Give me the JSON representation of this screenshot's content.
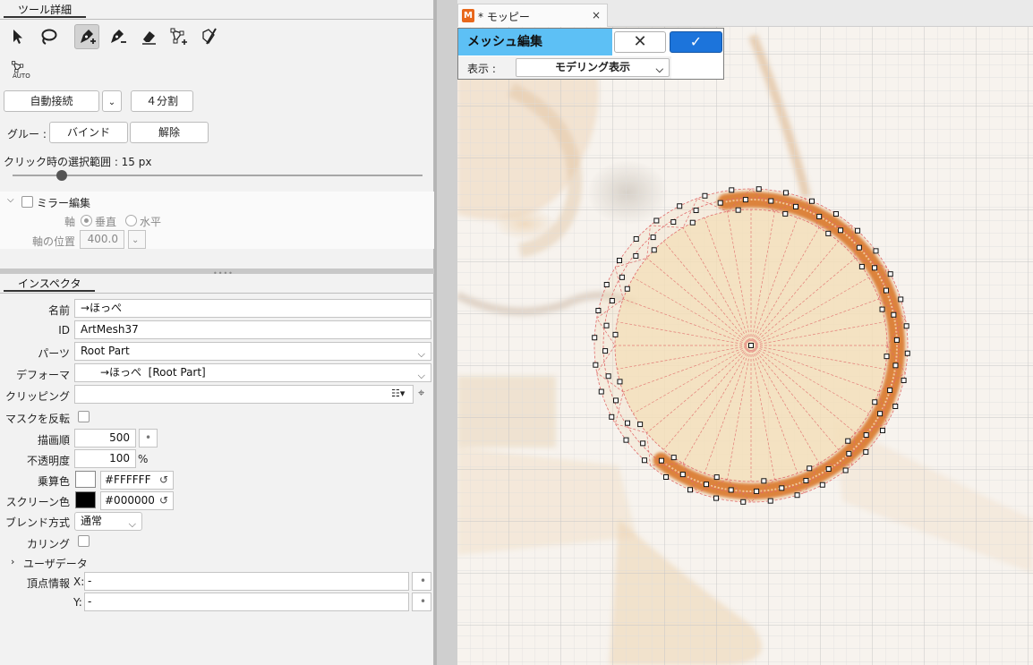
{
  "tool_details": {
    "tab_label": "ツール詳細",
    "tools": [
      {
        "name": "select-arrow-icon"
      },
      {
        "name": "lasso-icon"
      },
      {
        "name": "pen-add-icon",
        "active": true
      },
      {
        "name": "pen-remove-icon"
      },
      {
        "name": "eraser-icon"
      },
      {
        "name": "vertex-add-icon"
      },
      {
        "name": "knife-icon"
      },
      {
        "name": "auto-mesh-icon"
      }
    ],
    "auto_label": "AUTO",
    "connect_mode": "自動接続",
    "split_label": "４分割",
    "glue_label": "グルー :",
    "bind_label": "バインド",
    "release_label": "解除",
    "selection_range_label": "クリック時の選択範囲 : 15 px",
    "selection_range_fraction": 0.12,
    "mirror_label": "ミラー編集",
    "axis_label": "軸",
    "axis_vertical": "垂直",
    "axis_horizontal": "水平",
    "axis_position_label": "軸の位置",
    "axis_position_value": "400.0"
  },
  "inspector": {
    "tab_label": "インスペクタ",
    "name_label": "名前",
    "name_value": "→ほっぺ",
    "id_label": "ID",
    "id_value": "ArtMesh37",
    "parts_label": "パーツ",
    "parts_value": "Root Part",
    "deformer_label": "デフォーマ",
    "deformer_value": "→ほっぺ  [Root Part]",
    "clipping_label": "クリッピング",
    "clipping_value": "",
    "invert_mask_label": "マスクを反転",
    "draw_order_label": "描画順",
    "draw_order_value": "500",
    "opacity_label": "不透明度",
    "opacity_value": "100",
    "opacity_unit": "%",
    "multiply_label": "乗算色",
    "multiply_hex": "#FFFFFF",
    "multiply_color": "#ffffff",
    "screen_label": "スクリーン色",
    "screen_hex": "#000000",
    "screen_color": "#000000",
    "blend_label": "ブレンド方式",
    "blend_value": "通常",
    "culling_label": "カリング",
    "user_data_label": "ユーザデータ",
    "vertex_info_label": "頂点情報",
    "x_label": "X:",
    "x_value": "-",
    "y_label": "Y:",
    "y_value": "-"
  },
  "document": {
    "tab_title": "* モッピー",
    "app_icon_letter": "M",
    "close_symbol": "×"
  },
  "mesh_edit": {
    "title": "メッシュ編集",
    "cancel_symbol": "✕",
    "ok_symbol": "✓",
    "view_label": "表示 :",
    "view_value": "モデリング表示"
  },
  "colors": {
    "accent_blue": "#1c74db",
    "mesh_title_bg": "#5dc0f5",
    "stroke_orange": "#d9772a",
    "mesh_line": "#e06a6a",
    "fill_tan": "#f3dfb8"
  }
}
